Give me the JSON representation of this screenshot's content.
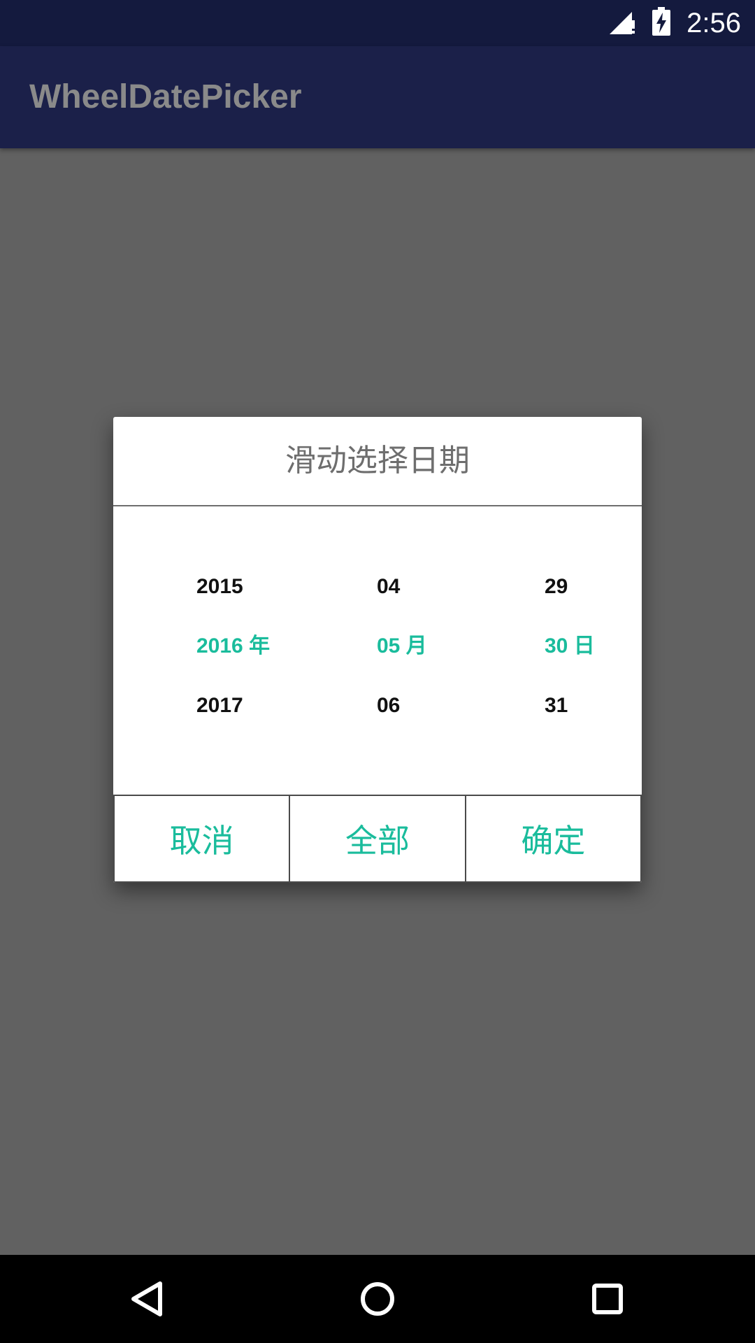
{
  "status_bar": {
    "time": "2:56",
    "icons": [
      "signal-alert-icon",
      "battery-charging-icon"
    ]
  },
  "app_bar": {
    "title": "WheelDatePicker"
  },
  "dialog": {
    "title": "滑动选择日期",
    "year_column": {
      "items": [
        "2015",
        "2016 年",
        "2017"
      ],
      "selected": "2016 年"
    },
    "month_column": {
      "items": [
        "04",
        "05 月",
        "06"
      ],
      "selected": "05 月"
    },
    "day_column": {
      "items": [
        "29",
        "30 日",
        "31"
      ],
      "selected": "30 日"
    },
    "buttons": {
      "cancel": "取消",
      "all": "全部",
      "confirm": "确定"
    }
  },
  "nav_bar": {
    "icons": [
      "back-icon",
      "home-icon",
      "recents-icon"
    ]
  },
  "colors": {
    "status_bar": "#141a3e",
    "app_bar": "#1b2049",
    "scrim": "#616161",
    "accent": "#1abc9c",
    "dialog_bg": "#ffffff"
  }
}
